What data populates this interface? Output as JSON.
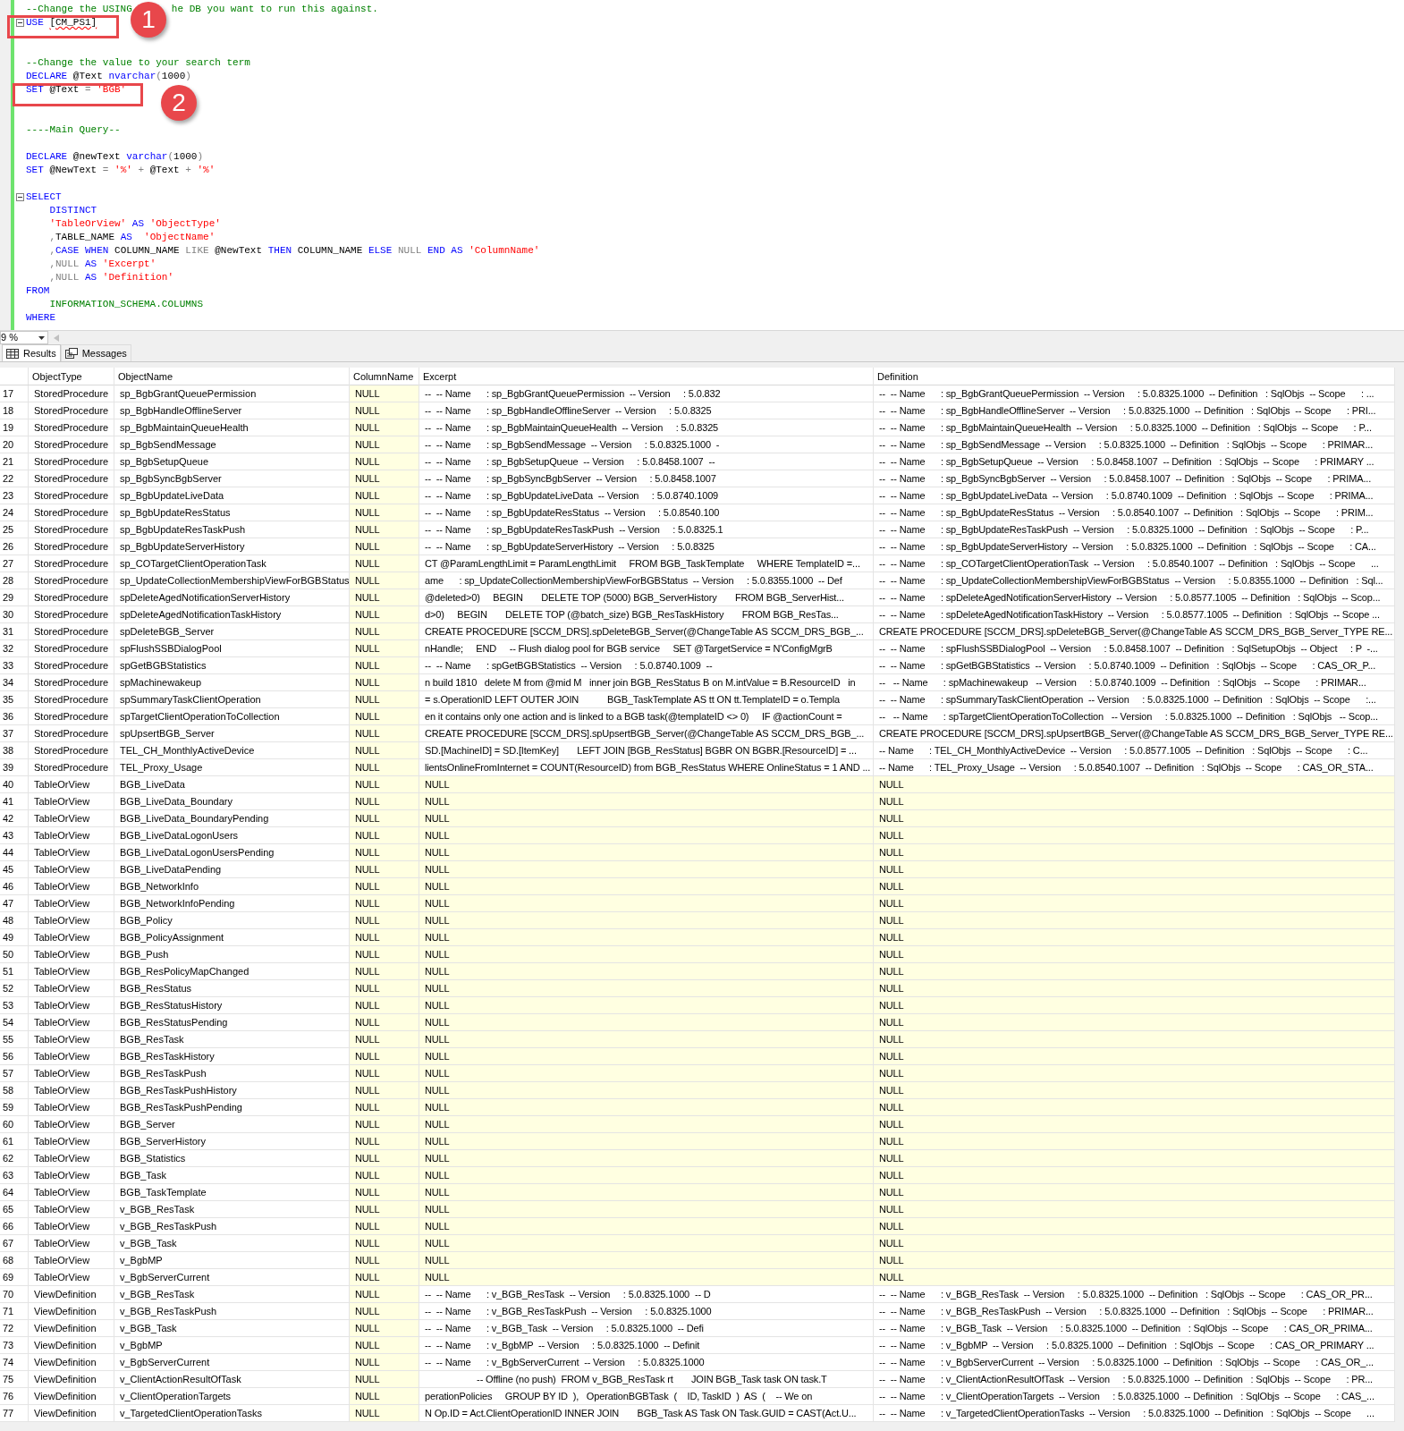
{
  "editor": {
    "lines": [
      {
        "fold": false,
        "tokens": [
          {
            "text": "--Change the USING",
            "kind": "comment"
          },
          {
            "text": "he DB you want to run this against.",
            "kind": "comment_after_badge"
          }
        ]
      },
      {
        "fold": true,
        "tokens": [
          {
            "text": "USE ",
            "kind": "keyword"
          },
          {
            "text": "[CM_PS1]",
            "kind": "error"
          }
        ]
      },
      {
        "fold": false
      },
      {
        "fold": false
      },
      {
        "fold": false,
        "tokens": [
          {
            "text": "--Change the value to your search term",
            "kind": "comment"
          }
        ]
      },
      {
        "fold": false,
        "tokens": [
          {
            "text": "DECLARE ",
            "kind": "keyword"
          },
          {
            "text": "@Text ",
            "kind": "plain"
          },
          {
            "text": "nvarchar",
            "kind": "keyword"
          },
          {
            "text": "(",
            "kind": "operator"
          },
          {
            "text": "1000",
            "kind": "plain"
          },
          {
            "text": ")",
            "kind": "operator"
          }
        ]
      },
      {
        "fold": false,
        "tokens": [
          {
            "text": "SET ",
            "kind": "keyword"
          },
          {
            "text": "@Text ",
            "kind": "plain"
          },
          {
            "text": "= ",
            "kind": "operator"
          },
          {
            "text": "'BGB'",
            "kind": "string"
          }
        ]
      },
      {
        "fold": false
      },
      {
        "fold": false
      },
      {
        "fold": false,
        "tokens": [
          {
            "text": "----Main Query--",
            "kind": "comment"
          }
        ]
      },
      {
        "fold": false
      },
      {
        "fold": false,
        "tokens": [
          {
            "text": "DECLARE ",
            "kind": "keyword"
          },
          {
            "text": "@newText ",
            "kind": "plain"
          },
          {
            "text": "varchar",
            "kind": "keyword"
          },
          {
            "text": "(",
            "kind": "operator"
          },
          {
            "text": "1000",
            "kind": "plain"
          },
          {
            "text": ")",
            "kind": "operator"
          }
        ]
      },
      {
        "fold": false,
        "tokens": [
          {
            "text": "SET ",
            "kind": "keyword"
          },
          {
            "text": "@NewText ",
            "kind": "plain"
          },
          {
            "text": "= ",
            "kind": "operator"
          },
          {
            "text": "'%' ",
            "kind": "string"
          },
          {
            "text": "+ ",
            "kind": "operator"
          },
          {
            "text": "@Text ",
            "kind": "plain"
          },
          {
            "text": "+ ",
            "kind": "operator"
          },
          {
            "text": "'%'",
            "kind": "string"
          }
        ]
      },
      {
        "fold": false
      },
      {
        "fold": true,
        "tokens": [
          {
            "text": "SELECT",
            "kind": "keyword"
          }
        ]
      },
      {
        "fold": false,
        "tokens": [
          {
            "text": "    DISTINCT",
            "kind": "keyword"
          }
        ]
      },
      {
        "fold": false,
        "tokens": [
          {
            "text": "    'TableOrView' ",
            "kind": "string"
          },
          {
            "text": "AS ",
            "kind": "keyword"
          },
          {
            "text": "'ObjectType'",
            "kind": "string"
          }
        ]
      },
      {
        "fold": false,
        "tokens": [
          {
            "text": "    ,",
            "kind": "operator"
          },
          {
            "text": "TABLE_NAME ",
            "kind": "plain"
          },
          {
            "text": "AS  ",
            "kind": "keyword"
          },
          {
            "text": "'ObjectName'",
            "kind": "string"
          }
        ]
      },
      {
        "fold": false,
        "tokens": [
          {
            "text": "    ,",
            "kind": "operator"
          },
          {
            "text": "CASE WHEN ",
            "kind": "keyword"
          },
          {
            "text": "COLUMN_NAME ",
            "kind": "plain"
          },
          {
            "text": "LIKE ",
            "kind": "operator"
          },
          {
            "text": "@NewText ",
            "kind": "plain"
          },
          {
            "text": "THEN ",
            "kind": "keyword"
          },
          {
            "text": "COLUMN_NAME ",
            "kind": "plain"
          },
          {
            "text": "ELSE ",
            "kind": "keyword"
          },
          {
            "text": "NULL ",
            "kind": "operator"
          },
          {
            "text": "END AS ",
            "kind": "keyword"
          },
          {
            "text": "'ColumnName'",
            "kind": "string"
          }
        ]
      },
      {
        "fold": false,
        "tokens": [
          {
            "text": "    ,NULL ",
            "kind": "operator"
          },
          {
            "text": "AS ",
            "kind": "keyword"
          },
          {
            "text": "'Excerpt'",
            "kind": "string"
          }
        ]
      },
      {
        "fold": false,
        "tokens": [
          {
            "text": "    ,NULL ",
            "kind": "operator"
          },
          {
            "text": "AS ",
            "kind": "keyword"
          },
          {
            "text": "'Definition'",
            "kind": "string"
          }
        ]
      },
      {
        "fold": false,
        "tokens": [
          {
            "text": "FROM",
            "kind": "keyword"
          }
        ]
      },
      {
        "fold": false,
        "tokens": [
          {
            "text": "    INFORMATION_SCHEMA.COLUMNS",
            "kind": "system"
          }
        ]
      },
      {
        "fold": false,
        "tokens": [
          {
            "text": "WHERE",
            "kind": "keyword"
          }
        ]
      }
    ]
  },
  "annotations": [
    {
      "number": "1"
    },
    {
      "number": "2"
    }
  ],
  "zoom": "9 %",
  "tabs": [
    {
      "label": "Results",
      "selected": true
    },
    {
      "label": "Messages",
      "selected": false
    }
  ],
  "grid": {
    "columns": [
      "ObjectType",
      "ObjectName",
      "ColumnName",
      "Excerpt",
      "Definition"
    ],
    "rows": [
      {
        "n": "17",
        "object_type": "StoredProcedure",
        "object_name": "sp_BgbGrantQueuePermission",
        "column_name": "NULL",
        "excerpt": "--  -- Name      : sp_BgbGrantQueuePermission  -- Version     : 5.0.832",
        "definition": "--  -- Name      : sp_BgbGrantQueuePermission  -- Version     : 5.0.8325.1000  -- Definition   : SqlObjs  -- Scope      : ...",
        "nulls": [
          true,
          false,
          false
        ]
      },
      {
        "n": "18",
        "object_type": "StoredProcedure",
        "object_name": "sp_BgbHandleOfflineServer",
        "column_name": "NULL",
        "excerpt": "--  -- Name      : sp_BgbHandleOfflineServer  -- Version     : 5.0.8325",
        "definition": "--  -- Name      : sp_BgbHandleOfflineServer  -- Version     : 5.0.8325.1000  -- Definition   : SqlObjs  -- Scope      : PRI...",
        "nulls": [
          true,
          false,
          false
        ]
      },
      {
        "n": "19",
        "object_type": "StoredProcedure",
        "object_name": "sp_BgbMaintainQueueHealth",
        "column_name": "NULL",
        "excerpt": "--  -- Name      : sp_BgbMaintainQueueHealth  -- Version     : 5.0.8325",
        "definition": "--  -- Name      : sp_BgbMaintainQueueHealth  -- Version     : 5.0.8325.1000  -- Definition   : SqlObjs  -- Scope      : P...",
        "nulls": [
          true,
          false,
          false
        ]
      },
      {
        "n": "20",
        "object_type": "StoredProcedure",
        "object_name": "sp_BgbSendMessage",
        "column_name": "NULL",
        "excerpt": "--  -- Name      : sp_BgbSendMessage  -- Version     : 5.0.8325.1000  -",
        "definition": "--  -- Name      : sp_BgbSendMessage  -- Version     : 5.0.8325.1000  -- Definition   : SqlObjs  -- Scope      : PRIMAR...",
        "nulls": [
          true,
          false,
          false
        ]
      },
      {
        "n": "21",
        "object_type": "StoredProcedure",
        "object_name": "sp_BgbSetupQueue",
        "column_name": "NULL",
        "excerpt": "--  -- Name      : sp_BgbSetupQueue  -- Version     : 5.0.8458.1007  --",
        "definition": "--  -- Name      : sp_BgbSetupQueue  -- Version     : 5.0.8458.1007  -- Definition   : SqlObjs  -- Scope      : PRIMARY ...",
        "nulls": [
          true,
          false,
          false
        ]
      },
      {
        "n": "22",
        "object_type": "StoredProcedure",
        "object_name": "sp_BgbSyncBgbServer",
        "column_name": "NULL",
        "excerpt": "--  -- Name      : sp_BgbSyncBgbServer  -- Version     : 5.0.8458.1007",
        "definition": "--  -- Name      : sp_BgbSyncBgbServer  -- Version     : 5.0.8458.1007  -- Definition   : SqlObjs  -- Scope      : PRIMA...",
        "nulls": [
          true,
          false,
          false
        ]
      },
      {
        "n": "23",
        "object_type": "StoredProcedure",
        "object_name": "sp_BgbUpdateLiveData",
        "column_name": "NULL",
        "excerpt": "--  -- Name      : sp_BgbUpdateLiveData  -- Version     : 5.0.8740.1009",
        "definition": "--  -- Name      : sp_BgbUpdateLiveData  -- Version     : 5.0.8740.1009  -- Definition   : SqlObjs  -- Scope      : PRIMA...",
        "nulls": [
          true,
          false,
          false
        ]
      },
      {
        "n": "24",
        "object_type": "StoredProcedure",
        "object_name": "sp_BgbUpdateResStatus",
        "column_name": "NULL",
        "excerpt": "--  -- Name      : sp_BgbUpdateResStatus  -- Version     : 5.0.8540.100",
        "definition": "--  -- Name      : sp_BgbUpdateResStatus  -- Version     : 5.0.8540.1007  -- Definition   : SqlObjs  -- Scope      : PRIM...",
        "nulls": [
          true,
          false,
          false
        ]
      },
      {
        "n": "25",
        "object_type": "StoredProcedure",
        "object_name": "sp_BgbUpdateResTaskPush",
        "column_name": "NULL",
        "excerpt": "--  -- Name      : sp_BgbUpdateResTaskPush  -- Version     : 5.0.8325.1",
        "definition": "--  -- Name      : sp_BgbUpdateResTaskPush  -- Version     : 5.0.8325.1000  -- Definition   : SqlObjs  -- Scope      : P...",
        "nulls": [
          true,
          false,
          false
        ]
      },
      {
        "n": "26",
        "object_type": "StoredProcedure",
        "object_name": "sp_BgbUpdateServerHistory",
        "column_name": "NULL",
        "excerpt": "--  -- Name      : sp_BgbUpdateServerHistory  -- Version     : 5.0.8325",
        "definition": "--  -- Name      : sp_BgbUpdateServerHistory  -- Version     : 5.0.8325.1000  -- Definition   : SqlObjs  -- Scope      : CA...",
        "nulls": [
          true,
          false,
          false
        ]
      },
      {
        "n": "27",
        "object_type": "StoredProcedure",
        "object_name": "sp_COTargetClientOperationTask",
        "column_name": "NULL",
        "excerpt": "CT @ParamLengthLimit = ParamLengthLimit     FROM BGB_TaskTemplate     WHERE TemplateID =...",
        "definition": "--  -- Name      : sp_COTargetClientOperationTask  -- Version     : 5.0.8540.1007  -- Definition   : SqlObjs  -- Scope      ...",
        "nulls": [
          true,
          false,
          false
        ]
      },
      {
        "n": "28",
        "object_type": "StoredProcedure",
        "object_name": "sp_UpdateCollectionMembershipViewForBGBStatus",
        "column_name": "NULL",
        "excerpt": "ame      : sp_UpdateCollectionMembershipViewForBGBStatus  -- Version     : 5.0.8355.1000  -- Def",
        "definition": "--  -- Name      : sp_UpdateCollectionMembershipViewForBGBStatus  -- Version     : 5.0.8355.1000  -- Definition   : Sql...",
        "nulls": [
          true,
          false,
          false
        ]
      },
      {
        "n": "29",
        "object_type": "StoredProcedure",
        "object_name": "spDeleteAgedNotificationServerHistory",
        "column_name": "NULL",
        "excerpt": "@deleted>0)     BEGIN       DELETE TOP (5000) BGB_ServerHistory       FROM BGB_ServerHist...",
        "definition": "--  -- Name      : spDeleteAgedNotificationServerHistory  -- Version     : 5.0.8577.1005  -- Definition   : SqlObjs  -- Scop...",
        "nulls": [
          true,
          false,
          false
        ]
      },
      {
        "n": "30",
        "object_type": "StoredProcedure",
        "object_name": "spDeleteAgedNotificationTaskHistory",
        "column_name": "NULL",
        "excerpt": "d>0)     BEGIN       DELETE TOP (@batch_size) BGB_ResTaskHistory       FROM BGB_ResTas...",
        "definition": "--  -- Name      : spDeleteAgedNotificationTaskHistory  -- Version     : 5.0.8577.1005  -- Definition   : SqlObjs  -- Scope ...",
        "nulls": [
          true,
          false,
          false
        ]
      },
      {
        "n": "31",
        "object_type": "StoredProcedure",
        "object_name": "spDeleteBGB_Server",
        "column_name": "NULL",
        "excerpt": "CREATE PROCEDURE [SCCM_DRS].spDeleteBGB_Server(@ChangeTable AS SCCM_DRS_BGB_...",
        "definition": "CREATE PROCEDURE [SCCM_DRS].spDeleteBGB_Server(@ChangeTable AS SCCM_DRS_BGB_Server_TYPE RE...",
        "nulls": [
          true,
          false,
          false
        ]
      },
      {
        "n": "32",
        "object_type": "StoredProcedure",
        "object_name": "spFlushSSBDialogPool",
        "column_name": "NULL",
        "excerpt": "nHandle;     END     -- Flush dialog pool for BGB service     SET @TargetService = N'ConfigMgrB",
        "definition": "--  -- Name      : spFlushSSBDialogPool  -- Version     : 5.0.8458.1007  -- Definition   : SqlSetupObjs  -- Object     : P  -...",
        "nulls": [
          true,
          false,
          false
        ]
      },
      {
        "n": "33",
        "object_type": "StoredProcedure",
        "object_name": "spGetBGBStatistics",
        "column_name": "NULL",
        "excerpt": "--  -- Name      : spGetBGBStatistics  -- Version     : 5.0.8740.1009  --",
        "definition": "--  -- Name      : spGetBGBStatistics  -- Version     : 5.0.8740.1009  -- Definition   : SqlObjs  -- Scope      : CAS_OR_P...",
        "nulls": [
          true,
          false,
          false
        ]
      },
      {
        "n": "34",
        "object_type": "StoredProcedure",
        "object_name": "spMachinewakeup",
        "column_name": "NULL",
        "excerpt": "n build 1810   delete M from @mid M   inner join BGB_ResStatus B on M.intValue = B.ResourceID   in",
        "definition": "--   -- Name      : spMachinewakeup   -- Version     : 5.0.8740.1009  -- Definition   : SqlObjs   -- Scope      : PRIMAR...",
        "nulls": [
          true,
          false,
          false
        ]
      },
      {
        "n": "35",
        "object_type": "StoredProcedure",
        "object_name": "spSummaryTaskClientOperation",
        "column_name": "NULL",
        "excerpt": "= s.OperationID LEFT OUTER JOIN           BGB_TaskTemplate AS tt ON tt.TemplateID = o.Templa",
        "definition": "--  -- Name      : spSummaryTaskClientOperation  -- Version     : 5.0.8325.1000  -- Definition   : SqlObjs  -- Scope      :...",
        "nulls": [
          true,
          false,
          false
        ]
      },
      {
        "n": "36",
        "object_type": "StoredProcedure",
        "object_name": "spTargetClientOperationToCollection",
        "column_name": "NULL",
        "excerpt": "en it contains only one action and is linked to a BGB task(@templateID <> 0)     IF @actionCount =",
        "definition": "--   -- Name      : spTargetClientOperationToCollection   -- Version     : 5.0.8325.1000  -- Definition   : SqlObjs   -- Scop...",
        "nulls": [
          true,
          false,
          false
        ]
      },
      {
        "n": "37",
        "object_type": "StoredProcedure",
        "object_name": "spUpsertBGB_Server",
        "column_name": "NULL",
        "excerpt": "CREATE PROCEDURE [SCCM_DRS].spUpsertBGB_Server(@ChangeTable AS SCCM_DRS_BGB_...",
        "definition": "CREATE PROCEDURE [SCCM_DRS].spUpsertBGB_Server(@ChangeTable AS SCCM_DRS_BGB_Server_TYPE RE...",
        "nulls": [
          true,
          false,
          false
        ]
      },
      {
        "n": "38",
        "object_type": "StoredProcedure",
        "object_name": "TEL_CH_MonthlyActiveDevice",
        "column_name": "NULL",
        "excerpt": "SD.[MachineID] = SD.[ItemKey]       LEFT JOIN [BGB_ResStatus] BGBR ON BGBR.[ResourceID] = ...",
        "definition": "-- Name      : TEL_CH_MonthlyActiveDevice  -- Version     : 5.0.8577.1005  -- Definition   : SqlObjs  -- Scope      : C...",
        "nulls": [
          true,
          false,
          false
        ]
      },
      {
        "n": "39",
        "object_type": "StoredProcedure",
        "object_name": "TEL_Proxy_Usage",
        "column_name": "NULL",
        "excerpt": "lientsOnlineFromInternet = COUNT(ResourceID) from BGB_ResStatus WHERE OnlineStatus = 1 AND ...",
        "definition": "-- Name      : TEL_Proxy_Usage  -- Version     : 5.0.8540.1007  -- Definition   : SqlObjs  -- Scope      : CAS_OR_STA...",
        "nulls": [
          true,
          false,
          false
        ]
      },
      {
        "n": "40",
        "object_type": "TableOrView",
        "object_name": "BGB_LiveData",
        "column_name": "NULL",
        "excerpt": "NULL",
        "definition": "NULL",
        "nulls": [
          true,
          true,
          true
        ]
      },
      {
        "n": "41",
        "object_type": "TableOrView",
        "object_name": "BGB_LiveData_Boundary",
        "column_name": "NULL",
        "excerpt": "NULL",
        "definition": "NULL",
        "nulls": [
          true,
          true,
          true
        ]
      },
      {
        "n": "42",
        "object_type": "TableOrView",
        "object_name": "BGB_LiveData_BoundaryPending",
        "column_name": "NULL",
        "excerpt": "NULL",
        "definition": "NULL",
        "nulls": [
          true,
          true,
          true
        ]
      },
      {
        "n": "43",
        "object_type": "TableOrView",
        "object_name": "BGB_LiveDataLogonUsers",
        "column_name": "NULL",
        "excerpt": "NULL",
        "definition": "NULL",
        "nulls": [
          true,
          true,
          true
        ]
      },
      {
        "n": "44",
        "object_type": "TableOrView",
        "object_name": "BGB_LiveDataLogonUsersPending",
        "column_name": "NULL",
        "excerpt": "NULL",
        "definition": "NULL",
        "nulls": [
          true,
          true,
          true
        ]
      },
      {
        "n": "45",
        "object_type": "TableOrView",
        "object_name": "BGB_LiveDataPending",
        "column_name": "NULL",
        "excerpt": "NULL",
        "definition": "NULL",
        "nulls": [
          true,
          true,
          true
        ]
      },
      {
        "n": "46",
        "object_type": "TableOrView",
        "object_name": "BGB_NetworkInfo",
        "column_name": "NULL",
        "excerpt": "NULL",
        "definition": "NULL",
        "nulls": [
          true,
          true,
          true
        ]
      },
      {
        "n": "47",
        "object_type": "TableOrView",
        "object_name": "BGB_NetworkInfoPending",
        "column_name": "NULL",
        "excerpt": "NULL",
        "definition": "NULL",
        "nulls": [
          true,
          true,
          true
        ]
      },
      {
        "n": "48",
        "object_type": "TableOrView",
        "object_name": "BGB_Policy",
        "column_name": "NULL",
        "excerpt": "NULL",
        "definition": "NULL",
        "nulls": [
          true,
          true,
          true
        ]
      },
      {
        "n": "49",
        "object_type": "TableOrView",
        "object_name": "BGB_PolicyAssignment",
        "column_name": "NULL",
        "excerpt": "NULL",
        "definition": "NULL",
        "nulls": [
          true,
          true,
          true
        ]
      },
      {
        "n": "50",
        "object_type": "TableOrView",
        "object_name": "BGB_Push",
        "column_name": "NULL",
        "excerpt": "NULL",
        "definition": "NULL",
        "nulls": [
          true,
          true,
          true
        ]
      },
      {
        "n": "51",
        "object_type": "TableOrView",
        "object_name": "BGB_ResPolicyMapChanged",
        "column_name": "NULL",
        "excerpt": "NULL",
        "definition": "NULL",
        "nulls": [
          true,
          true,
          true
        ]
      },
      {
        "n": "52",
        "object_type": "TableOrView",
        "object_name": "BGB_ResStatus",
        "column_name": "NULL",
        "excerpt": "NULL",
        "definition": "NULL",
        "nulls": [
          true,
          true,
          true
        ]
      },
      {
        "n": "53",
        "object_type": "TableOrView",
        "object_name": "BGB_ResStatusHistory",
        "column_name": "NULL",
        "excerpt": "NULL",
        "definition": "NULL",
        "nulls": [
          true,
          true,
          true
        ]
      },
      {
        "n": "54",
        "object_type": "TableOrView",
        "object_name": "BGB_ResStatusPending",
        "column_name": "NULL",
        "excerpt": "NULL",
        "definition": "NULL",
        "nulls": [
          true,
          true,
          true
        ]
      },
      {
        "n": "55",
        "object_type": "TableOrView",
        "object_name": "BGB_ResTask",
        "column_name": "NULL",
        "excerpt": "NULL",
        "definition": "NULL",
        "nulls": [
          true,
          true,
          true
        ]
      },
      {
        "n": "56",
        "object_type": "TableOrView",
        "object_name": "BGB_ResTaskHistory",
        "column_name": "NULL",
        "excerpt": "NULL",
        "definition": "NULL",
        "nulls": [
          true,
          true,
          true
        ]
      },
      {
        "n": "57",
        "object_type": "TableOrView",
        "object_name": "BGB_ResTaskPush",
        "column_name": "NULL",
        "excerpt": "NULL",
        "definition": "NULL",
        "nulls": [
          true,
          true,
          true
        ]
      },
      {
        "n": "58",
        "object_type": "TableOrView",
        "object_name": "BGB_ResTaskPushHistory",
        "column_name": "NULL",
        "excerpt": "NULL",
        "definition": "NULL",
        "nulls": [
          true,
          true,
          true
        ]
      },
      {
        "n": "59",
        "object_type": "TableOrView",
        "object_name": "BGB_ResTaskPushPending",
        "column_name": "NULL",
        "excerpt": "NULL",
        "definition": "NULL",
        "nulls": [
          true,
          true,
          true
        ]
      },
      {
        "n": "60",
        "object_type": "TableOrView",
        "object_name": "BGB_Server",
        "column_name": "NULL",
        "excerpt": "NULL",
        "definition": "NULL",
        "nulls": [
          true,
          true,
          true
        ]
      },
      {
        "n": "61",
        "object_type": "TableOrView",
        "object_name": "BGB_ServerHistory",
        "column_name": "NULL",
        "excerpt": "NULL",
        "definition": "NULL",
        "nulls": [
          true,
          true,
          true
        ]
      },
      {
        "n": "62",
        "object_type": "TableOrView",
        "object_name": "BGB_Statistics",
        "column_name": "NULL",
        "excerpt": "NULL",
        "definition": "NULL",
        "nulls": [
          true,
          true,
          true
        ]
      },
      {
        "n": "63",
        "object_type": "TableOrView",
        "object_name": "BGB_Task",
        "column_name": "NULL",
        "excerpt": "NULL",
        "definition": "NULL",
        "nulls": [
          true,
          true,
          true
        ]
      },
      {
        "n": "64",
        "object_type": "TableOrView",
        "object_name": "BGB_TaskTemplate",
        "column_name": "NULL",
        "excerpt": "NULL",
        "definition": "NULL",
        "nulls": [
          true,
          true,
          true
        ]
      },
      {
        "n": "65",
        "object_type": "TableOrView",
        "object_name": "v_BGB_ResTask",
        "column_name": "NULL",
        "excerpt": "NULL",
        "definition": "NULL",
        "nulls": [
          true,
          true,
          true
        ]
      },
      {
        "n": "66",
        "object_type": "TableOrView",
        "object_name": "v_BGB_ResTaskPush",
        "column_name": "NULL",
        "excerpt": "NULL",
        "definition": "NULL",
        "nulls": [
          true,
          true,
          true
        ]
      },
      {
        "n": "67",
        "object_type": "TableOrView",
        "object_name": "v_BGB_Task",
        "column_name": "NULL",
        "excerpt": "NULL",
        "definition": "NULL",
        "nulls": [
          true,
          true,
          true
        ]
      },
      {
        "n": "68",
        "object_type": "TableOrView",
        "object_name": "v_BgbMP",
        "column_name": "NULL",
        "excerpt": "NULL",
        "definition": "NULL",
        "nulls": [
          true,
          true,
          true
        ]
      },
      {
        "n": "69",
        "object_type": "TableOrView",
        "object_name": "v_BgbServerCurrent",
        "column_name": "NULL",
        "excerpt": "NULL",
        "definition": "NULL",
        "nulls": [
          true,
          true,
          true
        ]
      },
      {
        "n": "70",
        "object_type": "ViewDefinition",
        "object_name": "v_BGB_ResTask",
        "column_name": "NULL",
        "excerpt": "--  -- Name      : v_BGB_ResTask  -- Version     : 5.0.8325.1000  -- D",
        "definition": "--  -- Name      : v_BGB_ResTask  -- Version     : 5.0.8325.1000  -- Definition   : SqlObjs  -- Scope      : CAS_OR_PR...",
        "nulls": [
          true,
          false,
          false
        ]
      },
      {
        "n": "71",
        "object_type": "ViewDefinition",
        "object_name": "v_BGB_ResTaskPush",
        "column_name": "NULL",
        "excerpt": "--  -- Name      : v_BGB_ResTaskPush  -- Version     : 5.0.8325.1000",
        "definition": "--  -- Name      : v_BGB_ResTaskPush  -- Version     : 5.0.8325.1000  -- Definition   : SqlObjs  -- Scope      : PRIMAR...",
        "nulls": [
          true,
          false,
          false
        ]
      },
      {
        "n": "72",
        "object_type": "ViewDefinition",
        "object_name": "v_BGB_Task",
        "column_name": "NULL",
        "excerpt": "--  -- Name      : v_BGB_Task  -- Version     : 5.0.8325.1000  -- Defi",
        "definition": "--  -- Name      : v_BGB_Task  -- Version     : 5.0.8325.1000  -- Definition   : SqlObjs  -- Scope      : CAS_OR_PRIMA...",
        "nulls": [
          true,
          false,
          false
        ]
      },
      {
        "n": "73",
        "object_type": "ViewDefinition",
        "object_name": "v_BgbMP",
        "column_name": "NULL",
        "excerpt": "--  -- Name      : v_BgbMP  -- Version     : 5.0.8325.1000  -- Definit",
        "definition": "--  -- Name      : v_BgbMP  -- Version     : 5.0.8325.1000  -- Definition   : SqlObjs  -- Scope      : CAS_OR_PRIMARY ...",
        "nulls": [
          true,
          false,
          false
        ]
      },
      {
        "n": "74",
        "object_type": "ViewDefinition",
        "object_name": "v_BgbServerCurrent",
        "column_name": "NULL",
        "excerpt": "--  -- Name      : v_BgbServerCurrent  -- Version     : 5.0.8325.1000",
        "definition": "--  -- Name      : v_BgbServerCurrent  -- Version     : 5.0.8325.1000  -- Definition   : SqlObjs  -- Scope      : CAS_OR_...",
        "nulls": [
          true,
          false,
          false
        ]
      },
      {
        "n": "75",
        "object_type": "ViewDefinition",
        "object_name": "v_ClientActionResultOfTask",
        "column_name": "NULL",
        "excerpt": "                    -- Offline (no push)  FROM v_BGB_ResTask rt       JOIN BGB_Task task ON task.T",
        "definition": "--  -- Name      : v_ClientActionResultOfTask  -- Version     : 5.0.8325.1000  -- Definition   : SqlObjs  -- Scope      : PR...",
        "nulls": [
          true,
          false,
          false
        ]
      },
      {
        "n": "76",
        "object_type": "ViewDefinition",
        "object_name": "v_ClientOperationTargets",
        "column_name": "NULL",
        "excerpt": "perationPolicies     GROUP BY ID  ),   OperationBGBTask  (    ID, TaskID  )  AS  (    -- We on",
        "definition": "--  -- Name      : v_ClientOperationTargets  -- Version     : 5.0.8325.1000  -- Definition   : SqlObjs  -- Scope      : CAS_...",
        "nulls": [
          true,
          false,
          false
        ]
      },
      {
        "n": "77",
        "object_type": "ViewDefinition",
        "object_name": "v_TargetedClientOperationTasks",
        "column_name": "NULL",
        "excerpt": "N Op.ID = Act.ClientOperationID INNER JOIN       BGB_Task AS Task ON Task.GUID = CAST(Act.U...",
        "definition": "--  -- Name      : v_TargetedClientOperationTasks  -- Version     : 5.0.8325.1000  -- Definition   : SqlObjs  -- Scope      ...",
        "nulls": [
          true,
          false,
          false
        ]
      }
    ]
  }
}
